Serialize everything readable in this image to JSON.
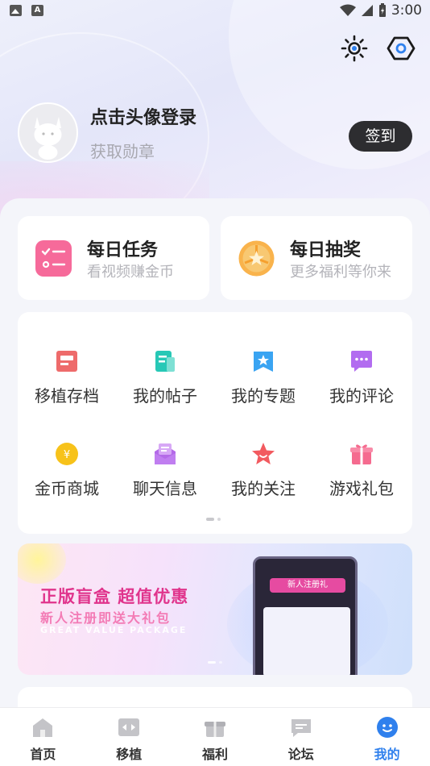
{
  "status_bar": {
    "time": "3:00"
  },
  "profile": {
    "login_prompt": "点击头像登录",
    "subtitle": "获取勋章",
    "signin_label": "签到"
  },
  "cards": {
    "daily_task": {
      "title": "每日任务",
      "subtitle": "看视频赚金币"
    },
    "daily_lottery": {
      "title": "每日抽奖",
      "subtitle": "更多福利等你来"
    }
  },
  "grid": {
    "items": [
      {
        "label": "移植存档",
        "icon": "save-archive-icon",
        "color": "#ee6b6b"
      },
      {
        "label": "我的帖子",
        "icon": "posts-icon",
        "color": "#27c8b6"
      },
      {
        "label": "我的专题",
        "icon": "topic-star-icon",
        "color": "#3aa4f2"
      },
      {
        "label": "我的评论",
        "icon": "comment-icon",
        "color": "#b26cf0"
      },
      {
        "label": "金币商城",
        "icon": "coin-shop-icon",
        "color": "#f7c21a"
      },
      {
        "label": "聊天信息",
        "icon": "chat-message-icon",
        "color": "#b46ae8"
      },
      {
        "label": "我的关注",
        "icon": "follow-star-icon",
        "color": "#f25a5f"
      },
      {
        "label": "游戏礼包",
        "icon": "gift-icon",
        "color": "#f56b8f"
      }
    ]
  },
  "banner": {
    "title": "正版盲盒 超值优惠",
    "subtitle": "新人注册即送大礼包",
    "english": "GREAT VALUE PACKAGE",
    "phone_header": "新人注册礼"
  },
  "tabs": [
    {
      "label": "首页",
      "icon": "home-icon"
    },
    {
      "label": "移植",
      "icon": "port-icon"
    },
    {
      "label": "福利",
      "icon": "gift-icon"
    },
    {
      "label": "论坛",
      "icon": "forum-icon"
    },
    {
      "label": "我的",
      "icon": "profile-face-icon",
      "active": true
    }
  ],
  "colors": {
    "accent": "#2f80ed",
    "dark_button": "#2d2d30"
  }
}
